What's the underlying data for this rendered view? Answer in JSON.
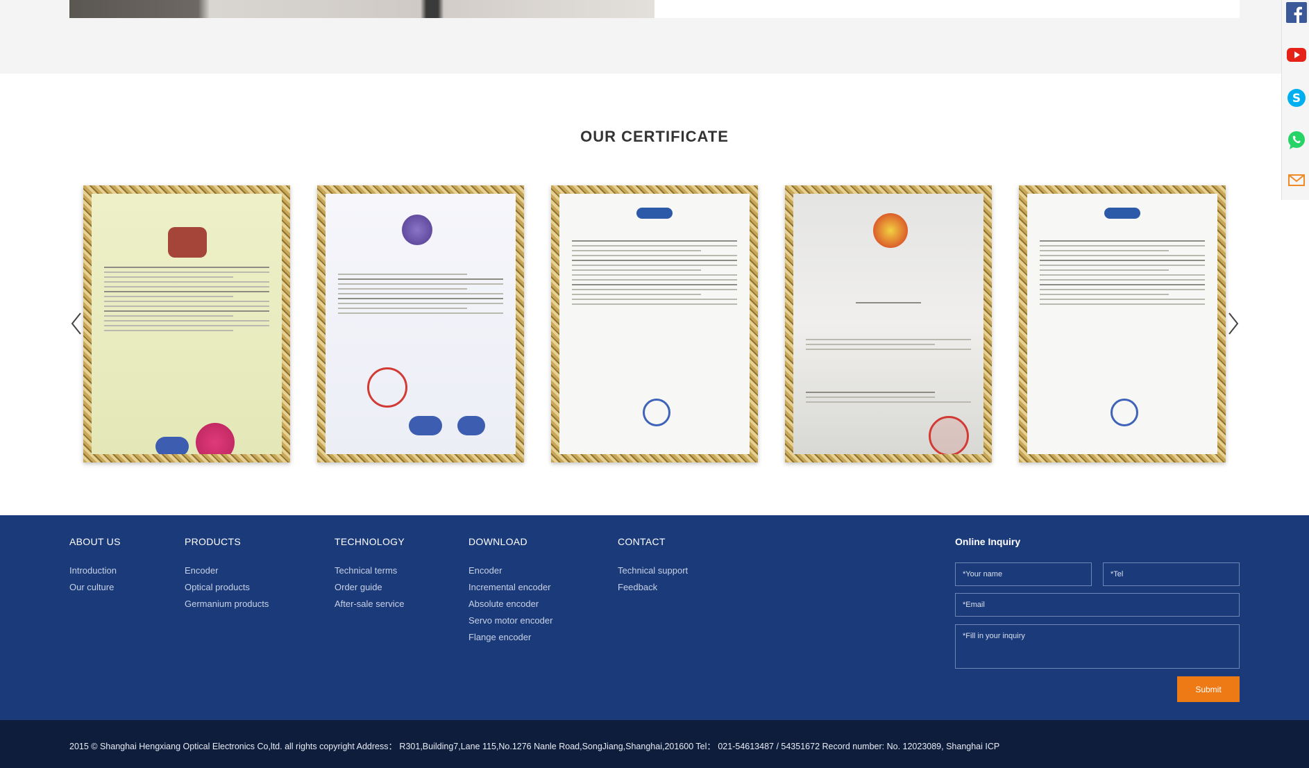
{
  "certificate_section": {
    "title": "OUR CERTIFICATE",
    "prev_label": "‹",
    "next_label": "›"
  },
  "social": [
    "facebook-icon",
    "youtube-icon",
    "skype-icon",
    "whatsapp-icon",
    "email-icon"
  ],
  "footer": {
    "columns": [
      {
        "heading": "ABOUT US",
        "links": [
          "Introduction",
          "Our culture"
        ]
      },
      {
        "heading": "PRODUCTS",
        "links": [
          "Encoder",
          "Optical products",
          "Germanium products"
        ]
      },
      {
        "heading": "TECHNOLOGY",
        "links": [
          "Technical terms",
          "Order guide",
          "After-sale service"
        ]
      },
      {
        "heading": "DOWNLOAD",
        "links": [
          "Encoder",
          "Incremental encoder",
          "Absolute encoder",
          "Servo motor encoder",
          "Flange encoder"
        ]
      },
      {
        "heading": "CONTACT",
        "links": [
          "Technical support",
          "Feedback"
        ]
      }
    ],
    "inquiry": {
      "title": "Online Inquiry",
      "name_placeholder": "*Your name",
      "tel_placeholder": "*Tel",
      "email_placeholder": "*Email",
      "message_placeholder": "*Fill in your inquiry",
      "submit_label": "Submit"
    }
  },
  "bottom_bar": {
    "text": "2015 © Shanghai Hengxiang Optical Electronics Co,ltd. all rights copyright Address：  R301,Building7,Lane 115,No.1276 Nanle Road,SongJiang,Shanghai,201600 Tel：  021-54613487 / 54351672 Record number: No. 12023089, Shanghai ICP"
  },
  "colors": {
    "footer_bg": "#1b3a7a",
    "bottom_bar_bg": "#0f1d3c",
    "submit_bg": "#ee7a16"
  }
}
